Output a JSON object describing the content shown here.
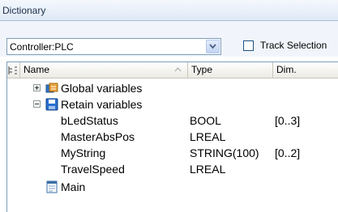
{
  "panel": {
    "title": "Dictionary"
  },
  "toolbar": {
    "controller_select": {
      "value": "Controller:PLC"
    },
    "track_selection": {
      "label": "Track Selection",
      "checked": false
    }
  },
  "grid": {
    "columns": {
      "name": "Name",
      "type": "Type",
      "dim": "Dim."
    },
    "rows": [
      {
        "name": "Global variables",
        "type": "",
        "dim": "",
        "kind": "group",
        "expanded": false,
        "icon": "global-variables-icon"
      },
      {
        "name": "Retain variables",
        "type": "",
        "dim": "",
        "kind": "group",
        "expanded": true,
        "icon": "save-disk-icon"
      },
      {
        "name": "bLedStatus",
        "type": "BOOL",
        "dim": "[0..3]",
        "kind": "variable"
      },
      {
        "name": "MasterAbsPos",
        "type": "LREAL",
        "dim": "",
        "kind": "variable"
      },
      {
        "name": "MyString",
        "type": "STRING(100)",
        "dim": "[0..2]",
        "kind": "variable"
      },
      {
        "name": "TravelSpeed",
        "type": "LREAL",
        "dim": "",
        "kind": "variable"
      },
      {
        "name": "Main",
        "type": "",
        "dim": "",
        "kind": "program",
        "icon": "program-icon"
      }
    ]
  },
  "colors": {
    "title_text": "#1b2f4a",
    "toolbar_bg": "#f1f5fb",
    "border": "#7f9db9"
  }
}
